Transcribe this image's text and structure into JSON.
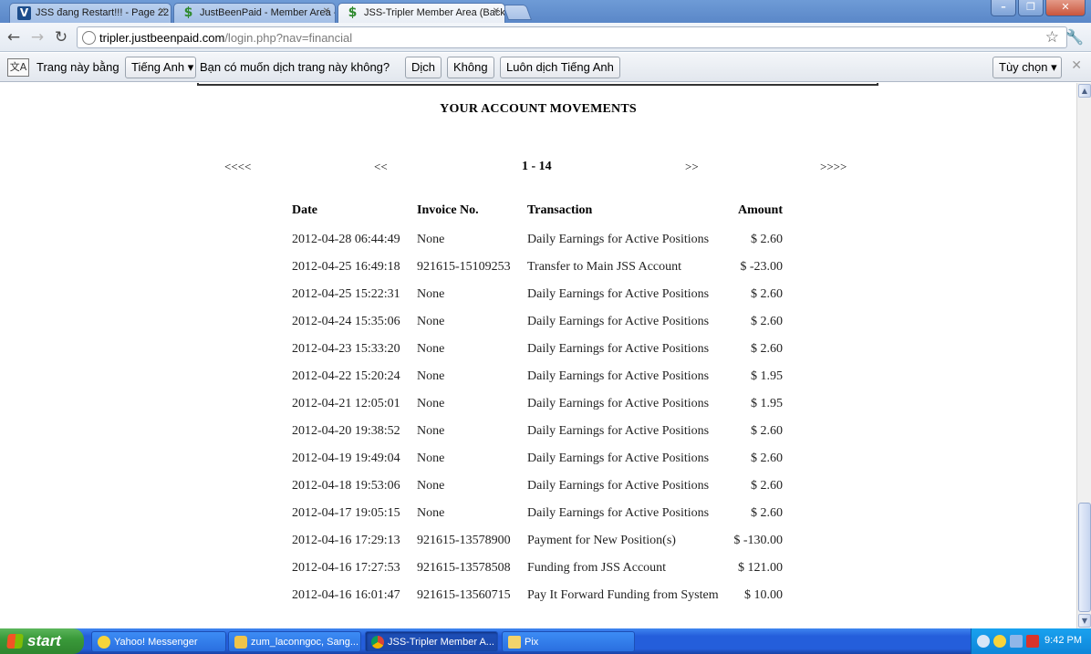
{
  "browser": {
    "tabs": [
      {
        "title": "JSS đang Restart!!! - Page 22"
      },
      {
        "title": "JustBeenPaid - Member Area -"
      },
      {
        "title": "JSS-Tripler Member Area (Back"
      }
    ],
    "url_host": "tripler.justbeenpaid.com",
    "url_path": "/login.php?nav=financial",
    "translate": {
      "prefix": "Trang này bằng",
      "language": "Tiếng Anh",
      "question": "Bạn có muốn dịch trang này không?",
      "translate_btn": "Dịch",
      "no_btn": "Không",
      "always_btn": "Luôn dịch Tiếng Anh",
      "options_btn": "Tùy chọn"
    }
  },
  "page": {
    "heading": "YOUR ACCOUNT MOVEMENTS",
    "pager": {
      "first": "<<<<",
      "prev": "<<",
      "current": "1 - 14",
      "next": ">>",
      "last": ">>>>"
    },
    "table": {
      "headers": {
        "date": "Date",
        "invoice": "Invoice No.",
        "transaction": "Transaction",
        "amount": "Amount"
      },
      "rows": [
        {
          "date": "2012-04-28 06:44:49",
          "invoice": "None",
          "transaction": "Daily Earnings for Active Positions",
          "amount": "$ 2.60"
        },
        {
          "date": "2012-04-25 16:49:18",
          "invoice": "921615-15109253",
          "transaction": "Transfer to Main JSS Account",
          "amount": "$ -23.00"
        },
        {
          "date": "2012-04-25 15:22:31",
          "invoice": "None",
          "transaction": "Daily Earnings for Active Positions",
          "amount": "$ 2.60"
        },
        {
          "date": "2012-04-24 15:35:06",
          "invoice": "None",
          "transaction": "Daily Earnings for Active Positions",
          "amount": "$ 2.60"
        },
        {
          "date": "2012-04-23 15:33:20",
          "invoice": "None",
          "transaction": "Daily Earnings for Active Positions",
          "amount": "$ 2.60"
        },
        {
          "date": "2012-04-22 15:20:24",
          "invoice": "None",
          "transaction": "Daily Earnings for Active Positions",
          "amount": "$ 1.95"
        },
        {
          "date": "2012-04-21 12:05:01",
          "invoice": "None",
          "transaction": "Daily Earnings for Active Positions",
          "amount": "$ 1.95"
        },
        {
          "date": "2012-04-20 19:38:52",
          "invoice": "None",
          "transaction": "Daily Earnings for Active Positions",
          "amount": "$ 2.60"
        },
        {
          "date": "2012-04-19 19:49:04",
          "invoice": "None",
          "transaction": "Daily Earnings for Active Positions",
          "amount": "$ 2.60"
        },
        {
          "date": "2012-04-18 19:53:06",
          "invoice": "None",
          "transaction": "Daily Earnings for Active Positions",
          "amount": "$ 2.60"
        },
        {
          "date": "2012-04-17 19:05:15",
          "invoice": "None",
          "transaction": "Daily Earnings for Active Positions",
          "amount": "$ 2.60"
        },
        {
          "date": "2012-04-16 17:29:13",
          "invoice": "921615-13578900",
          "transaction": "Payment for New Position(s)",
          "amount": "$ -130.00"
        },
        {
          "date": "2012-04-16 17:27:53",
          "invoice": "921615-13578508",
          "transaction": "Funding from JSS Account",
          "amount": "$ 121.00"
        },
        {
          "date": "2012-04-16 16:01:47",
          "invoice": "921615-13560715",
          "transaction": "Pay It Forward Funding from System",
          "amount": "$ 10.00"
        }
      ]
    }
  },
  "taskbar": {
    "start_label": "start",
    "tasks": [
      {
        "label": "Yahoo! Messenger",
        "icon": "yahoo-messenger-icon"
      },
      {
        "label": "zum_laconngoc, Sang...",
        "icon": "chat-window-icon"
      },
      {
        "label": "JSS-Tripler Member A...",
        "icon": "chrome-icon"
      },
      {
        "label": "Pix",
        "icon": "folder-icon"
      }
    ],
    "clock": "9:42 PM"
  }
}
